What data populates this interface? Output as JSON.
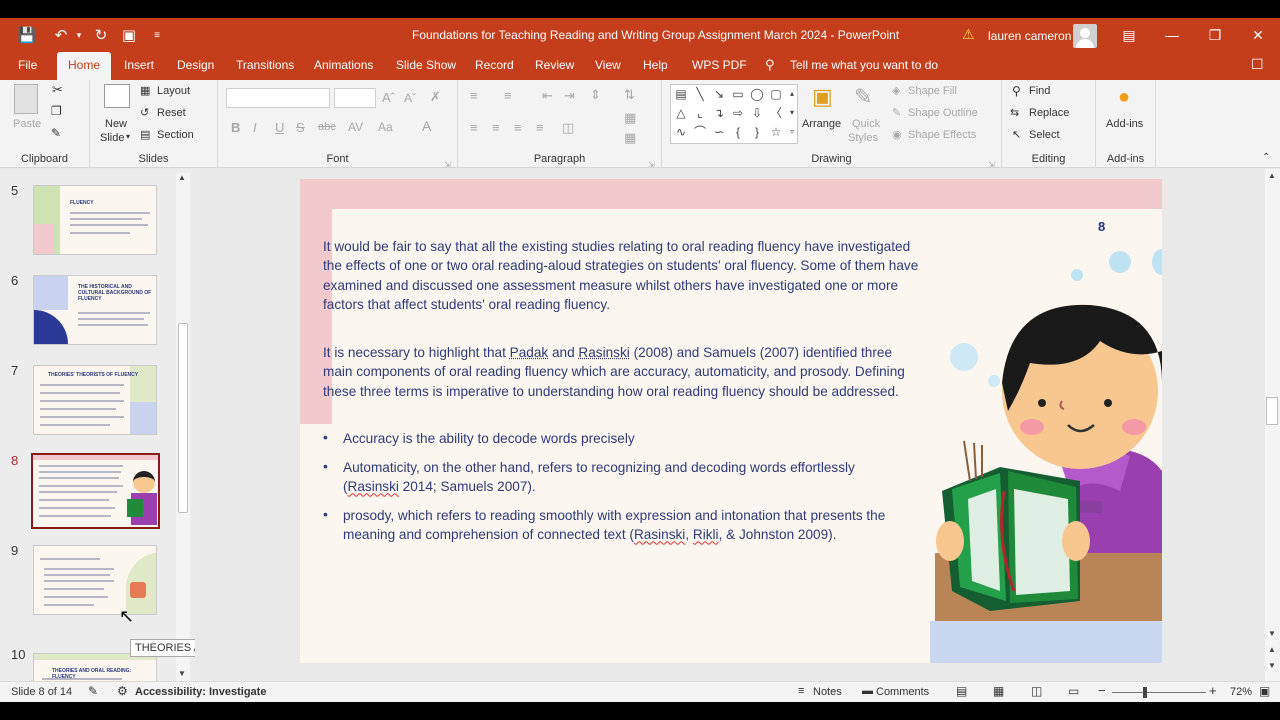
{
  "title_bar": {
    "doc_title": "Foundations for Teaching Reading and Writing Group Assignment March 2024  -  PowerPoint",
    "user_name": "lauren cameron"
  },
  "menu": {
    "tabs": [
      "File",
      "Home",
      "Insert",
      "Design",
      "Transitions",
      "Animations",
      "Slide Show",
      "Record",
      "Review",
      "View",
      "Help",
      "WPS PDF"
    ],
    "tell_me": "Tell me what you want to do"
  },
  "ribbon": {
    "clipboard": {
      "paste": "Paste",
      "label": "Clipboard"
    },
    "slides": {
      "new_slide_1": "New",
      "new_slide_2": "Slide",
      "layout": "Layout",
      "reset": "Reset",
      "section": "Section",
      "label": "Slides"
    },
    "font": {
      "label": "Font"
    },
    "paragraph": {
      "label": "Paragraph"
    },
    "drawing": {
      "arrange": "Arrange",
      "quick_styles_1": "Quick",
      "quick_styles_2": "Styles",
      "shape_fill": "Shape Fill",
      "shape_outline": "Shape Outline",
      "shape_effects": "Shape Effects",
      "label": "Drawing"
    },
    "editing": {
      "find": "Find",
      "replace": "Replace",
      "select": "Select",
      "label": "Editing"
    },
    "addins": {
      "addins": "Add-ins",
      "label": "Add-ins"
    }
  },
  "slide_panel": {
    "thumbnails": [
      {
        "number": "5",
        "title": "FLUENCY"
      },
      {
        "number": "6",
        "title": "THE HISTORICAL AND CULTURAL BACKGROUND OF FLUENCY"
      },
      {
        "number": "7",
        "title": "THEORIES' THEORISTS OF FLUENCY"
      },
      {
        "number": "8",
        "title": ""
      },
      {
        "number": "9",
        "title": ""
      },
      {
        "number": "10",
        "title": "THEORIES AND ORAL READING: FLUENCY"
      }
    ],
    "tooltip": "THEORIES AND ORAL READING..."
  },
  "slide": {
    "number": "8",
    "p1": "It would be fair to say that all the existing studies relating to oral reading fluency have investigated the effects of one or two oral reading-aloud strategies on students' oral fluency. Some of them have examined and discussed one assessment measure whilst others have investigated one or more factors that affect students' oral reading fluency.",
    "p2_a": " It is necessary to highlight that ",
    "p2_padak": "Padak",
    "p2_b": " and ",
    "p2_rasinski": "Rasinski",
    "p2_c": " (2008) and Samuels (2007) identified three main components of oral reading fluency which are accuracy, automaticity, and prosody. Defining these three terms is imperative to understanding how oral reading fluency should be addressed.",
    "b1": "Accuracy is the ability to decode words precisely",
    "b2_a": "Automaticity, on the other hand, refers to recognizing and decoding words effortlessly (",
    "b2_rasinski": "Rasinski",
    "b2_b": " 2014; Samuels 2007).",
    "b3_a": " prosody, which refers to reading smoothly with expression and intonation that presents the meaning and comprehension of connected text (",
    "b3_rasinski": "Rasinski",
    "b3_mid": ", ",
    "b3_rikli": "Rikli",
    "b3_b": ", & Johnston 2009)."
  },
  "status_bar": {
    "slide_count": "Slide 8 of 14",
    "accessibility": "Accessibility: Investigate",
    "notes": "Notes",
    "comments": "Comments",
    "zoom": "72%"
  },
  "colors": {
    "brand": "#c43e1c",
    "slide_text": "#2e3a7a",
    "active_thumb_border": "#8b1a1a"
  }
}
